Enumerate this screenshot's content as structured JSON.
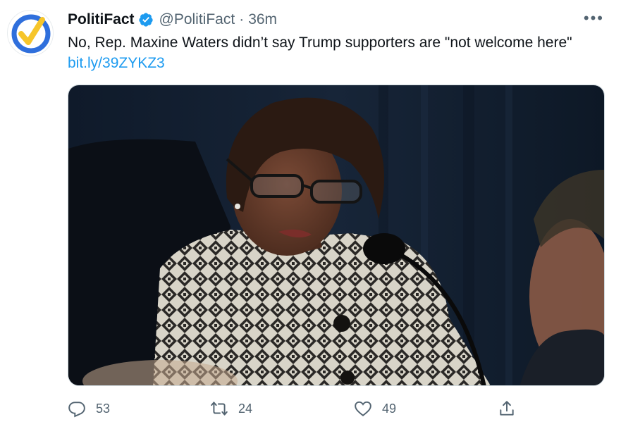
{
  "author": {
    "name": "PolitiFact",
    "handle": "@PolitiFact",
    "separator": "·",
    "time": "36m",
    "avatar_icon": "politifact-check-logo",
    "verified_icon": "verified-badge-icon"
  },
  "tweet": {
    "text": "No, Rep. Maxine Waters didn’t say Trump supporters are \"not welcome here\"",
    "link": "bit.ly/39ZYKZ3",
    "media_description_icon": "photo"
  },
  "actions": {
    "replies": "53",
    "retweets": "24",
    "likes": "49"
  },
  "colors": {
    "accent": "#1d9bf0",
    "muted": "#536471",
    "text": "#0f1419",
    "logo_blue": "#2f6fdc",
    "logo_yellow": "#f6c52a"
  }
}
